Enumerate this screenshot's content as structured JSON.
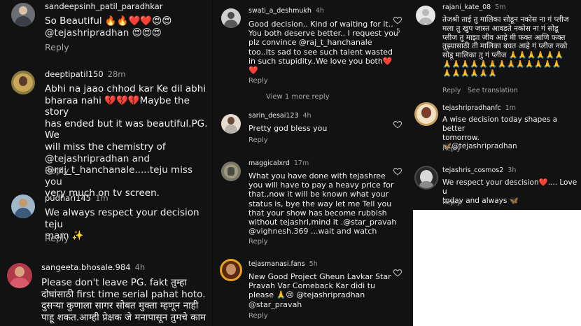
{
  "panel_left": {
    "comments": [
      {
        "user": "sandeepsinh_patil_paradhkar",
        "time": "",
        "lines": [
          "So Beautiful 🔥🔥❤️❤️😍😍",
          "@tejashripradhan 😍😍😍"
        ],
        "reply": "Reply"
      },
      {
        "user": "deeptipatil150",
        "time": "28m",
        "lines": [
          "Abhi na jaao chhod kar Ke dil abhi",
          "bharaa nahi 💔💔💔Maybe the story",
          "has ended but it was beautiful.PG. We",
          "will miss the chemistry of",
          "@tejashripradhan and",
          "@raj_t_hanchanale.....teju miss you",
          "very much on tv screen."
        ],
        "reply": "Reply"
      },
      {
        "user": "pudhari145",
        "time": "1m",
        "lines": [
          "We always respect your decision teju",
          "mam ✨"
        ],
        "reply": "Reply"
      },
      {
        "user": "sangeeta.bhosale.984",
        "time": "4h",
        "lines": [
          "Please don't leave PG. fakt तुम्हा",
          "दोघांसाठी first time serial pahat hoto.",
          "दुसऱ्या कुणाला सागर सोबत मुक्ता म्हणून नाही",
          "पाहू शकत.आम्ही प्रेक्षक जे मनापासून तुमचे काम"
        ],
        "reply": ""
      }
    ]
  },
  "panel_middle": {
    "comments": [
      {
        "user": "swati_a_deshmukh",
        "time": "4h",
        "lines": [
          "Good decision.. Kind of waiting for it..",
          "You both deserve better.. I request you",
          "plz convince @raj_t_hanchanale",
          "too..Its sad to see such talent wasted",
          "in such stupidity..We love you both❤️",
          "❤️"
        ],
        "reply": "Reply",
        "likes": "5"
      },
      {
        "view_more": "View 1 more reply"
      },
      {
        "user": "sarin_desai123",
        "time": "4h",
        "lines": [
          "Pretty god bless you"
        ],
        "reply": "Reply"
      },
      {
        "user": "maggicalxrd",
        "time": "17m",
        "lines": [
          "What you have done with tejashree",
          "you will have to pay a heavy price for",
          "that.,now it will be known what your",
          "status is, bye the way let me Tell you",
          "that your show has become rubbish",
          "without tejashri,mind it .@star_pravah",
          "@vighnesh.369 ...wait and watch"
        ],
        "reply": "Reply"
      },
      {
        "user": "tejasmanasi.fans",
        "time": "5h",
        "lines": [
          "New Good Project Gheun Lavkar Star",
          "Pravah Var Comeback Kar didi tu",
          "please 🙏😢 @tejashripradhan",
          "@star_pravah"
        ],
        "reply": "Reply"
      }
    ]
  },
  "panel_right": {
    "comments": [
      {
        "user": "rajani_kate_08",
        "time": "5m",
        "lines": [
          "तेजश्री ताई तु मालिका सोडून नकोस ना गं प्लीज",
          "मला तु खुप जास्त आवडते नकोस ना गं सोडू",
          "प्लीज तु माझा जीव आहे मी फक्त आणि फक्त",
          "तुझ्यासाठी ती मालिका बघत आहे गं प्लीज नको",
          "सोडू मालिका तु गं प्लीज 🙏🙏🙏🙏🙏🙏",
          "🙏🙏🙏🙏🙏🙏🙏🙏🙏🙏🙏🙏🙏",
          "🙏🙏🙏🙏🙏🙏"
        ],
        "reply": "Reply",
        "translate": "See translation"
      },
      {
        "user": "tejashripradhanfc",
        "time": "1m",
        "lines": [
          "A wise decision today shapes a better",
          "tomorrow.",
          "🦋@tejashripradhan"
        ],
        "reply": "Reply"
      },
      {
        "user": "tejashris_cosmos2",
        "time": "3h",
        "lines": [
          "We respect your descision❤️.... Love u",
          "today and always 🦋"
        ],
        "reply": "Reply"
      }
    ]
  },
  "colors": {
    "background": "#121212",
    "text": "#f5f5f5",
    "muted": "#a8a8a8"
  }
}
